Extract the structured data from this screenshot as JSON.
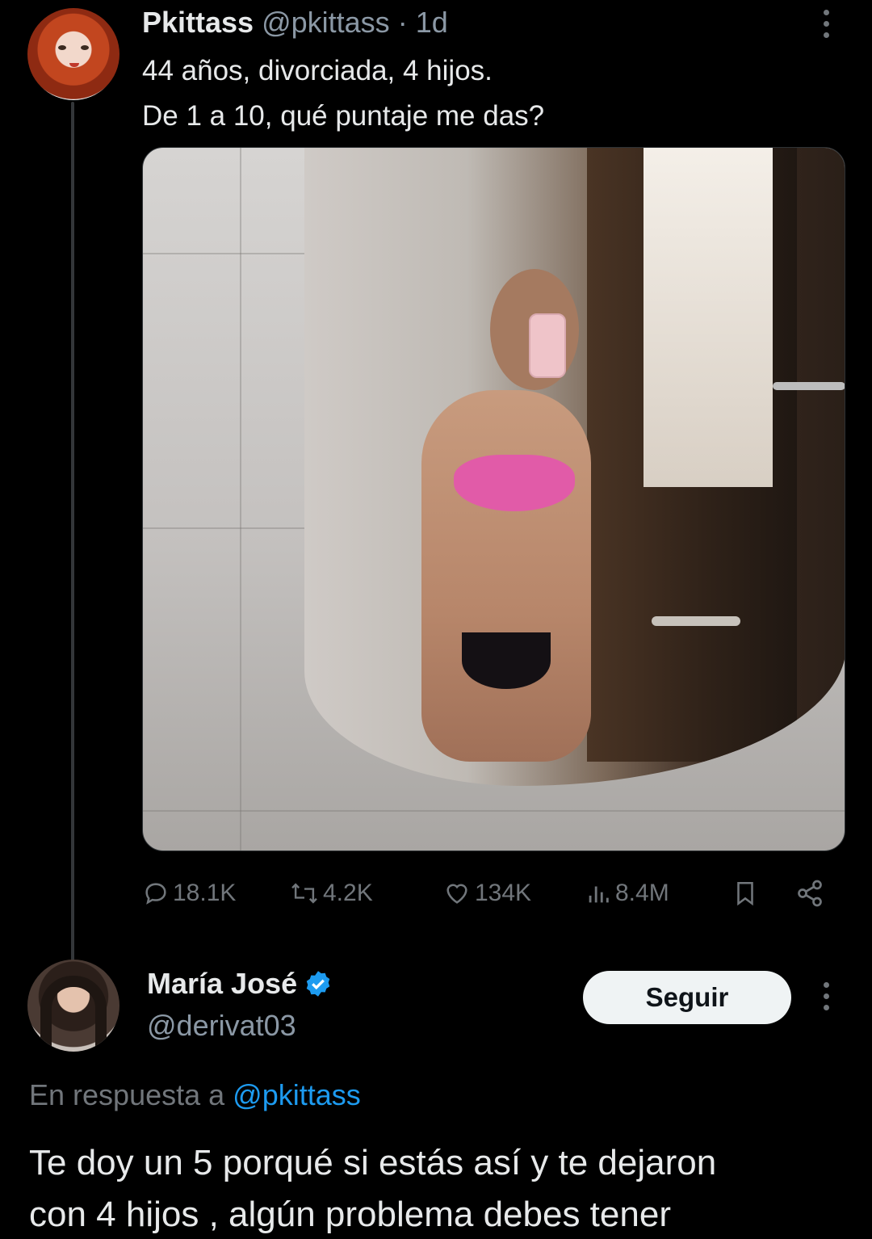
{
  "tweet": {
    "author": {
      "name": "Pkittass",
      "handle": "@pkittass",
      "age": "1d",
      "separator": "·"
    },
    "text_lines": [
      "44 años, divorciada, 4 hijos.",
      "De 1 a 10, qué puntaje me das?"
    ],
    "stats": {
      "replies": "18.1K",
      "reposts": "4.2K",
      "likes": "134K",
      "views": "8.4M"
    }
  },
  "reply": {
    "author": {
      "name": "María José",
      "handle": "@derivat03",
      "verified": true
    },
    "follow_label": "Seguir",
    "in_reply_prefix": "En respuesta a",
    "in_reply_mention": "@pkittass",
    "text_lines": [
      "Te doy un 5 porqué si estás así y te dejaron",
      "con 4 hijos , algún problema debes tener"
    ]
  },
  "colors": {
    "background": "#000000",
    "text": "#e7e9ea",
    "muted": "#71767b",
    "link": "#1d9bf0",
    "verified": "#1d9bf0"
  },
  "icons": [
    "more-icon",
    "reply-icon",
    "repost-icon",
    "like-icon",
    "views-icon",
    "bookmark-icon",
    "share-icon",
    "verified-badge-icon"
  ]
}
